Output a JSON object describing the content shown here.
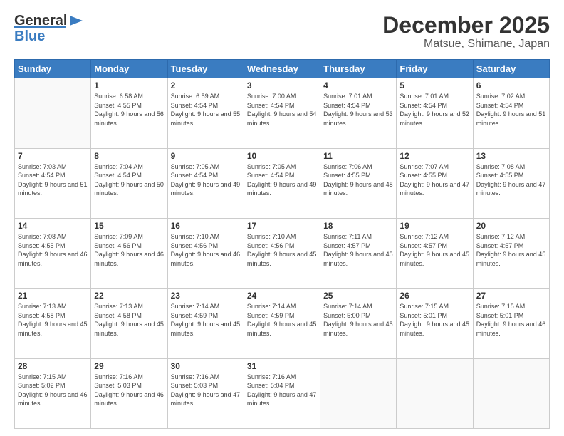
{
  "header": {
    "logo_line1": "General",
    "logo_line2": "Blue",
    "month": "December 2025",
    "location": "Matsue, Shimane, Japan"
  },
  "weekdays": [
    "Sunday",
    "Monday",
    "Tuesday",
    "Wednesday",
    "Thursday",
    "Friday",
    "Saturday"
  ],
  "weeks": [
    [
      {
        "day": "",
        "sunrise": "",
        "sunset": "",
        "daylight": ""
      },
      {
        "day": "1",
        "sunrise": "6:58 AM",
        "sunset": "4:55 PM",
        "daylight": "9 hours and 56 minutes."
      },
      {
        "day": "2",
        "sunrise": "6:59 AM",
        "sunset": "4:54 PM",
        "daylight": "9 hours and 55 minutes."
      },
      {
        "day": "3",
        "sunrise": "7:00 AM",
        "sunset": "4:54 PM",
        "daylight": "9 hours and 54 minutes."
      },
      {
        "day": "4",
        "sunrise": "7:01 AM",
        "sunset": "4:54 PM",
        "daylight": "9 hours and 53 minutes."
      },
      {
        "day": "5",
        "sunrise": "7:01 AM",
        "sunset": "4:54 PM",
        "daylight": "9 hours and 52 minutes."
      },
      {
        "day": "6",
        "sunrise": "7:02 AM",
        "sunset": "4:54 PM",
        "daylight": "9 hours and 51 minutes."
      }
    ],
    [
      {
        "day": "7",
        "sunrise": "7:03 AM",
        "sunset": "4:54 PM",
        "daylight": "9 hours and 51 minutes."
      },
      {
        "day": "8",
        "sunrise": "7:04 AM",
        "sunset": "4:54 PM",
        "daylight": "9 hours and 50 minutes."
      },
      {
        "day": "9",
        "sunrise": "7:05 AM",
        "sunset": "4:54 PM",
        "daylight": "9 hours and 49 minutes."
      },
      {
        "day": "10",
        "sunrise": "7:05 AM",
        "sunset": "4:54 PM",
        "daylight": "9 hours and 49 minutes."
      },
      {
        "day": "11",
        "sunrise": "7:06 AM",
        "sunset": "4:55 PM",
        "daylight": "9 hours and 48 minutes."
      },
      {
        "day": "12",
        "sunrise": "7:07 AM",
        "sunset": "4:55 PM",
        "daylight": "9 hours and 47 minutes."
      },
      {
        "day": "13",
        "sunrise": "7:08 AM",
        "sunset": "4:55 PM",
        "daylight": "9 hours and 47 minutes."
      }
    ],
    [
      {
        "day": "14",
        "sunrise": "7:08 AM",
        "sunset": "4:55 PM",
        "daylight": "9 hours and 46 minutes."
      },
      {
        "day": "15",
        "sunrise": "7:09 AM",
        "sunset": "4:56 PM",
        "daylight": "9 hours and 46 minutes."
      },
      {
        "day": "16",
        "sunrise": "7:10 AM",
        "sunset": "4:56 PM",
        "daylight": "9 hours and 46 minutes."
      },
      {
        "day": "17",
        "sunrise": "7:10 AM",
        "sunset": "4:56 PM",
        "daylight": "9 hours and 45 minutes."
      },
      {
        "day": "18",
        "sunrise": "7:11 AM",
        "sunset": "4:57 PM",
        "daylight": "9 hours and 45 minutes."
      },
      {
        "day": "19",
        "sunrise": "7:12 AM",
        "sunset": "4:57 PM",
        "daylight": "9 hours and 45 minutes."
      },
      {
        "day": "20",
        "sunrise": "7:12 AM",
        "sunset": "4:57 PM",
        "daylight": "9 hours and 45 minutes."
      }
    ],
    [
      {
        "day": "21",
        "sunrise": "7:13 AM",
        "sunset": "4:58 PM",
        "daylight": "9 hours and 45 minutes."
      },
      {
        "day": "22",
        "sunrise": "7:13 AM",
        "sunset": "4:58 PM",
        "daylight": "9 hours and 45 minutes."
      },
      {
        "day": "23",
        "sunrise": "7:14 AM",
        "sunset": "4:59 PM",
        "daylight": "9 hours and 45 minutes."
      },
      {
        "day": "24",
        "sunrise": "7:14 AM",
        "sunset": "4:59 PM",
        "daylight": "9 hours and 45 minutes."
      },
      {
        "day": "25",
        "sunrise": "7:14 AM",
        "sunset": "5:00 PM",
        "daylight": "9 hours and 45 minutes."
      },
      {
        "day": "26",
        "sunrise": "7:15 AM",
        "sunset": "5:01 PM",
        "daylight": "9 hours and 45 minutes."
      },
      {
        "day": "27",
        "sunrise": "7:15 AM",
        "sunset": "5:01 PM",
        "daylight": "9 hours and 46 minutes."
      }
    ],
    [
      {
        "day": "28",
        "sunrise": "7:15 AM",
        "sunset": "5:02 PM",
        "daylight": "9 hours and 46 minutes."
      },
      {
        "day": "29",
        "sunrise": "7:16 AM",
        "sunset": "5:03 PM",
        "daylight": "9 hours and 46 minutes."
      },
      {
        "day": "30",
        "sunrise": "7:16 AM",
        "sunset": "5:03 PM",
        "daylight": "9 hours and 47 minutes."
      },
      {
        "day": "31",
        "sunrise": "7:16 AM",
        "sunset": "5:04 PM",
        "daylight": "9 hours and 47 minutes."
      },
      {
        "day": "",
        "sunrise": "",
        "sunset": "",
        "daylight": ""
      },
      {
        "day": "",
        "sunrise": "",
        "sunset": "",
        "daylight": ""
      },
      {
        "day": "",
        "sunrise": "",
        "sunset": "",
        "daylight": ""
      }
    ]
  ]
}
